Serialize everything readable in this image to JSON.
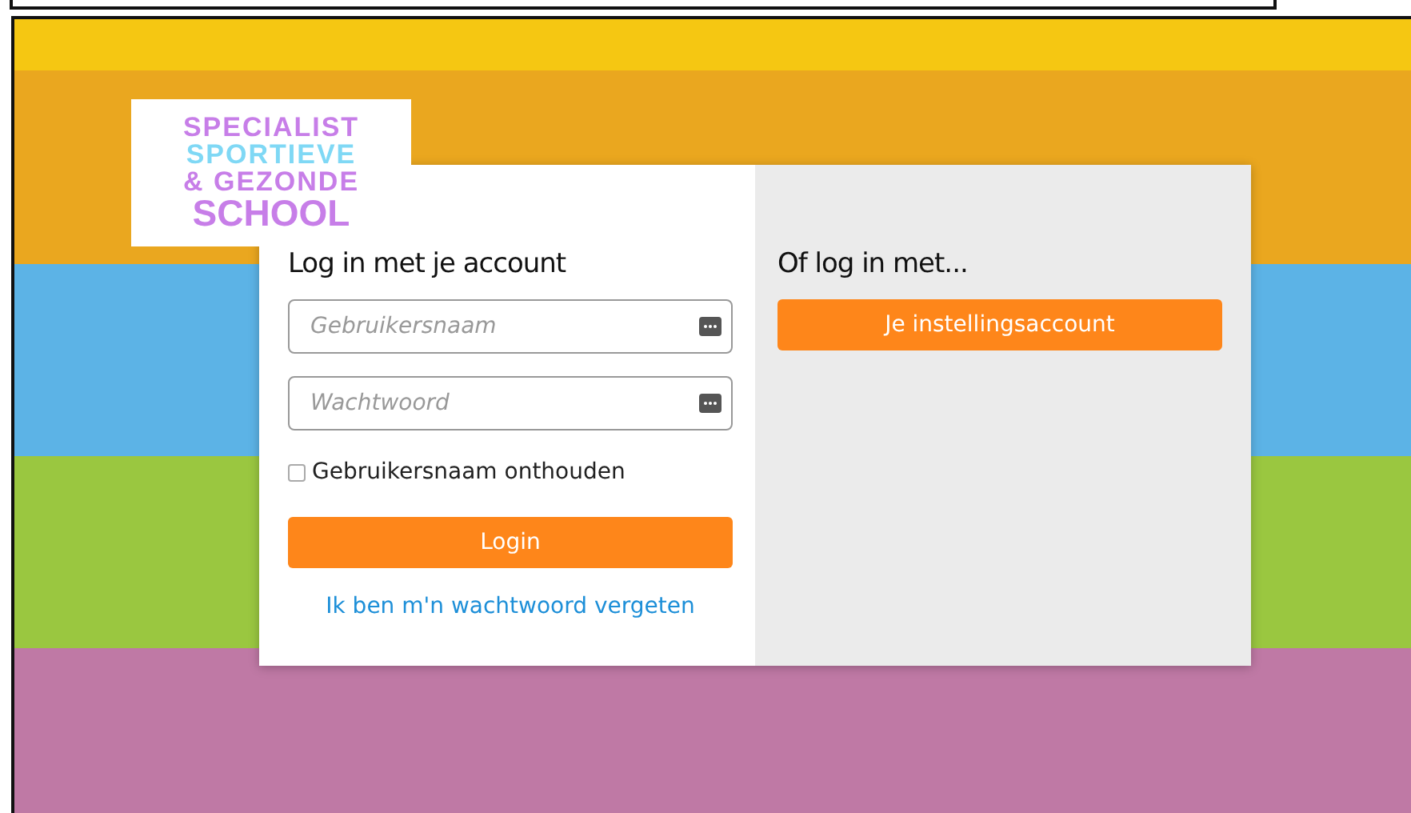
{
  "logo": {
    "lines": [
      {
        "text": "SPECIALIST",
        "color": "#c77ee8"
      },
      {
        "text": "SPORTIEVE",
        "color": "#7fd8f5"
      },
      {
        "text": "& GEZONDE",
        "color": "#c77ee8"
      },
      {
        "text": "SCHOOL",
        "color": "#c77ee8"
      }
    ]
  },
  "login": {
    "title": "Log in met je account",
    "fields": [
      {
        "placeholder": "Gebruikersnaam"
      },
      {
        "placeholder": "Wachtwoord"
      }
    ],
    "remember": {
      "label": "Gebruikersnaam onthouden",
      "checked": false
    },
    "button": "Login",
    "forgot": "Ik ben m'n wachtwoord vergeten"
  },
  "alternative": {
    "title": "Of log in met...",
    "button": "Je instellingsaccount"
  }
}
